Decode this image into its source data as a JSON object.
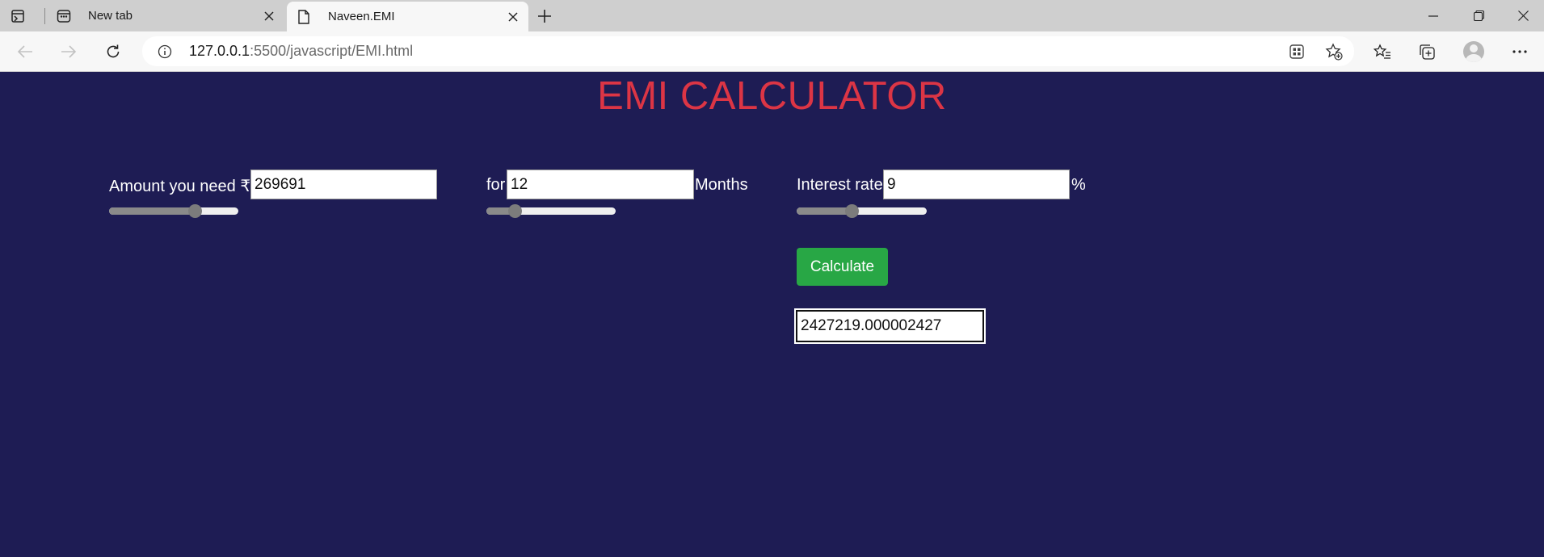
{
  "browser": {
    "tabs": [
      {
        "title": "New tab",
        "active": false,
        "icon": "new-tab-page-icon"
      },
      {
        "title": "Naveen.EMI",
        "active": true,
        "icon": "document-icon"
      }
    ],
    "url_host": "127.0.0.1",
    "url_rest": ":5500/javascript/EMI.html"
  },
  "page": {
    "title": "EMI CALCULATOR",
    "amount": {
      "label": "Amount you need ₹",
      "value": "269691",
      "slider_fraction": 0.66
    },
    "duration": {
      "label_before": "for",
      "value": "12",
      "label_after": "Months",
      "slider_fraction": 0.22
    },
    "interest": {
      "label": "Interest rate",
      "value": "9",
      "label_after": "%",
      "slider_fraction": 0.42
    },
    "calculate_label": "Calculate",
    "result_value": "2427219.000002427"
  },
  "colors": {
    "page_bg": "#1e1c54",
    "heading": "#dc3545",
    "button": "#28a745"
  }
}
